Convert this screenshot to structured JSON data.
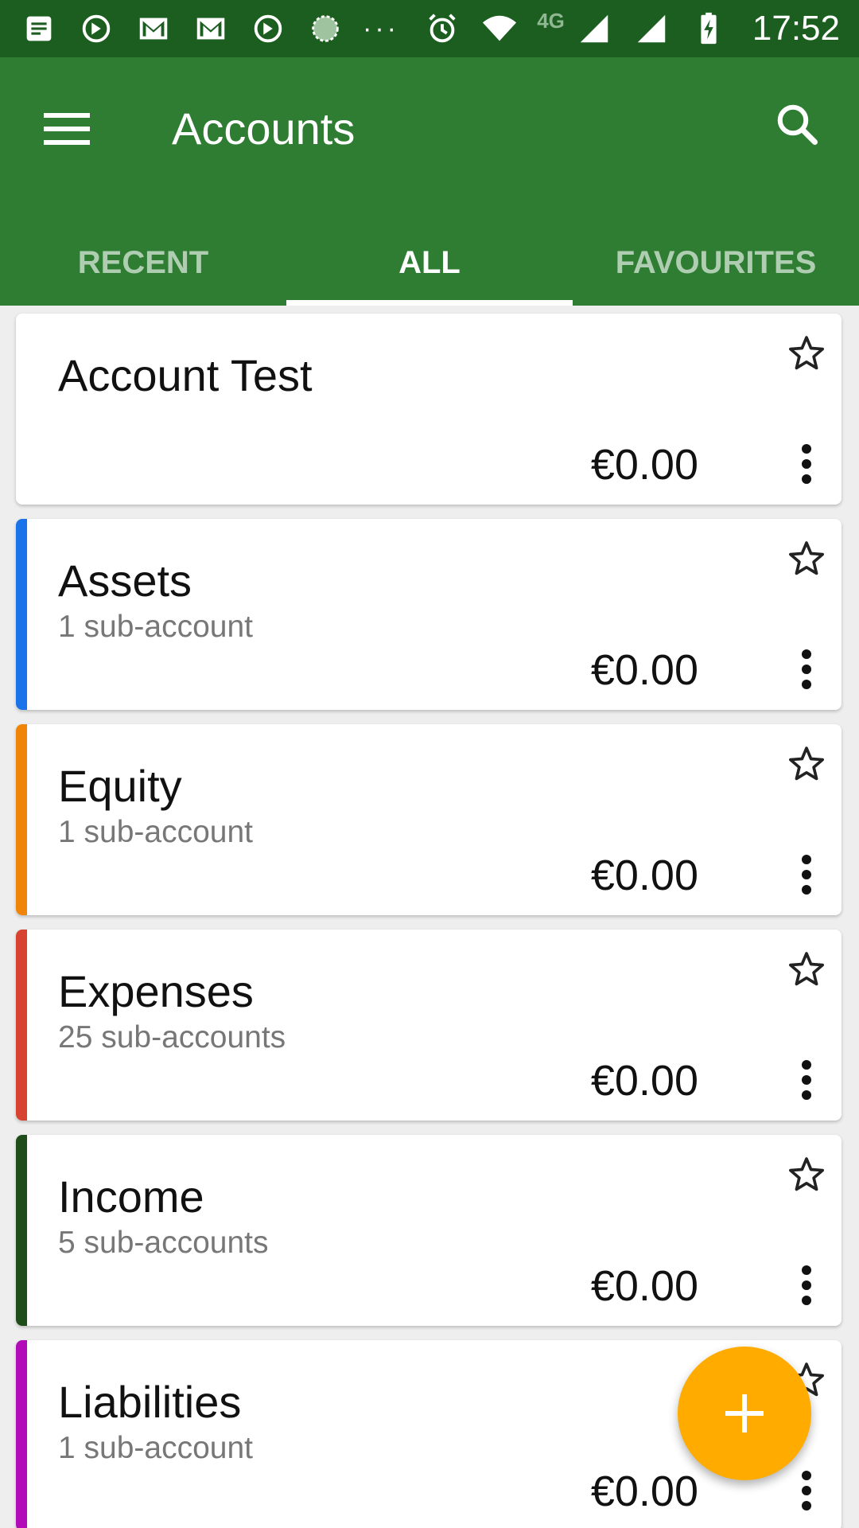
{
  "status_bar": {
    "time": "17:52",
    "network": "4G",
    "icons": [
      "notes-icon",
      "sync-icon",
      "gmail-icon",
      "gmail-icon",
      "sync-icon",
      "loading-icon",
      "more-notifications-icon",
      "alarm-icon",
      "wifi-icon",
      "signal-icon",
      "signal-icon",
      "battery-charging-icon"
    ]
  },
  "app_bar": {
    "title": "Accounts",
    "menu_icon": "hamburger-menu-icon",
    "search_icon": "search-icon",
    "color": "#2e7d32"
  },
  "tabs": [
    {
      "label": "RECENT",
      "active": false
    },
    {
      "label": "ALL",
      "active": true
    },
    {
      "label": "FAVOURITES",
      "active": false
    }
  ],
  "accounts": [
    {
      "name": "Account Test",
      "sub": "",
      "balance": "€0.00",
      "color": "#ffffff"
    },
    {
      "name": "Assets",
      "sub": "1 sub-account",
      "balance": "€0.00",
      "color": "#1a73e8"
    },
    {
      "name": "Equity",
      "sub": "1 sub-account",
      "balance": "€0.00",
      "color": "#ef8407"
    },
    {
      "name": "Expenses",
      "sub": "25 sub-accounts",
      "balance": "€0.00",
      "color": "#d84230"
    },
    {
      "name": "Income",
      "sub": "5 sub-accounts",
      "balance": "€0.00",
      "color": "#1e4d19"
    },
    {
      "name": "Liabilities",
      "sub": "1 sub-account",
      "balance": "€0.00",
      "color": "#b10cb8"
    }
  ],
  "fab": {
    "icon": "plus-icon",
    "color": "#ffab00"
  }
}
